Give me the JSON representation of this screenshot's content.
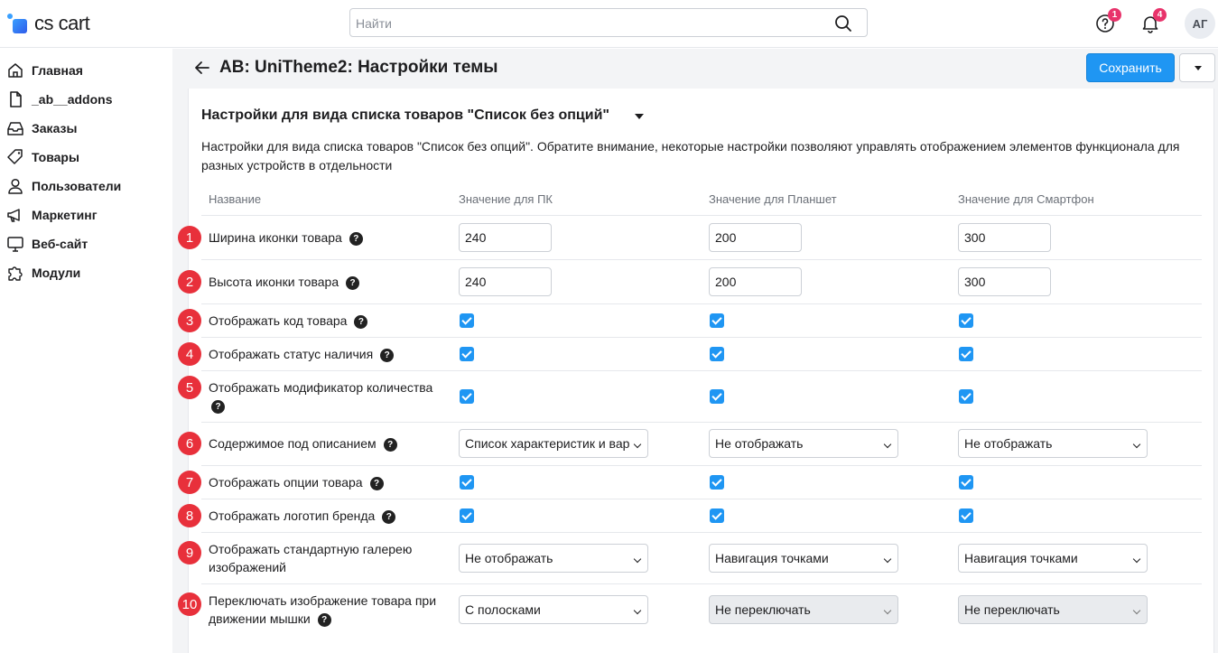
{
  "header": {
    "logo_text": "cs cart",
    "search_placeholder": "Найти",
    "help_badge": "1",
    "notifications_badge": "4",
    "avatar_initials": "АГ"
  },
  "sidebar": {
    "items": [
      {
        "label": "Главная",
        "icon": "home-icon"
      },
      {
        "label": "_ab__addons",
        "icon": "file-icon"
      },
      {
        "label": "Заказы",
        "icon": "inbox-icon"
      },
      {
        "label": "Товары",
        "icon": "tag-icon"
      },
      {
        "label": "Пользователи",
        "icon": "user-icon"
      },
      {
        "label": "Маркетинг",
        "icon": "megaphone-icon"
      },
      {
        "label": "Веб-сайт",
        "icon": "monitor-icon"
      },
      {
        "label": "Модули",
        "icon": "puzzle-icon"
      }
    ]
  },
  "page": {
    "title": "AB: UniTheme2: Настройки темы",
    "save_label": "Сохранить"
  },
  "section": {
    "title": "Настройки для вида списка товаров \"Список без опций\"",
    "description": "Настройки для вида списка товаров \"Список без опций\". Обратите внимание, некоторые настройки позволяют управлять отображением элементов функционала для разных устройств в отдельности"
  },
  "table": {
    "headers": [
      "Название",
      "Значение для ПК",
      "Значение для Планшет",
      "Значение для Смартфон"
    ],
    "rows": [
      {
        "num": "1",
        "label": "Ширина иконки товара",
        "pc": "240",
        "tablet": "200",
        "phone": "300"
      },
      {
        "num": "2",
        "label": "Высота иконки товара",
        "pc": "240",
        "tablet": "200",
        "phone": "300"
      },
      {
        "num": "3",
        "label": "Отображать код товара",
        "pc": true,
        "tablet": true,
        "phone": true
      },
      {
        "num": "4",
        "label": "Отображать статус наличия",
        "pc": true,
        "tablet": true,
        "phone": true
      },
      {
        "num": "5",
        "label": "Отображать модификатор количества",
        "pc": true,
        "tablet": true,
        "phone": true
      },
      {
        "num": "6",
        "label": "Содержимое под описанием",
        "pc": "Список характеристик и вар",
        "tablet": "Не отображать",
        "phone": "Не отображать"
      },
      {
        "num": "7",
        "label": "Отображать опции товара",
        "pc": true,
        "tablet": true,
        "phone": true
      },
      {
        "num": "8",
        "label": "Отображать логотип бренда",
        "pc": true,
        "tablet": true,
        "phone": true
      },
      {
        "num": "9",
        "label": "Отображать стандартную галерею изображений",
        "pc": "Не отображать",
        "tablet": "Навигация точками",
        "phone": "Навигация точками"
      },
      {
        "num": "10",
        "label": "Переключать изображение товара при движении мышки",
        "pc": "С полосками",
        "tablet": "Не переключать",
        "phone": "Не переключать"
      }
    ],
    "help_glyph": "?"
  },
  "colors": {
    "accent": "#1f96f3",
    "number_badge": "#e8303b",
    "notif_badge": "#e8336b"
  }
}
